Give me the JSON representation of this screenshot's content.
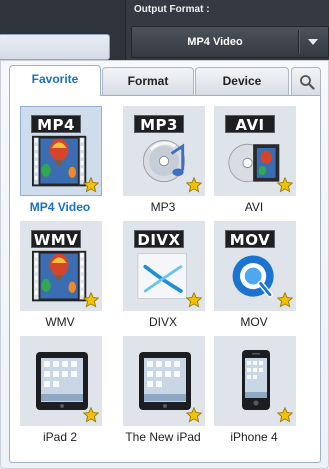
{
  "header": {
    "output_format_label": "Output Format :",
    "selected_format": "MP4 Video"
  },
  "tabs": [
    {
      "label": "Favorite",
      "active": true
    },
    {
      "label": "Format",
      "active": false
    },
    {
      "label": "Device",
      "active": false
    }
  ],
  "search_icon": "search-icon",
  "items": [
    {
      "label": "MP4 Video",
      "badge": "MP4",
      "kind": "video-film",
      "selected": true,
      "favorite": true
    },
    {
      "label": "MP3",
      "badge": "MP3",
      "kind": "audio-disc",
      "selected": false,
      "favorite": true
    },
    {
      "label": "AVI",
      "badge": "AVI",
      "kind": "disc-film",
      "selected": false,
      "favorite": true
    },
    {
      "label": "WMV",
      "badge": "WMV",
      "kind": "video-film",
      "selected": false,
      "favorite": true
    },
    {
      "label": "DIVX",
      "badge": "DIVX",
      "kind": "divx-logo",
      "selected": false,
      "favorite": true
    },
    {
      "label": "MOV",
      "badge": "MOV",
      "kind": "quicktime-logo",
      "selected": false,
      "favorite": true
    },
    {
      "label": "iPad 2",
      "badge": "",
      "kind": "tablet",
      "selected": false,
      "favorite": true
    },
    {
      "label": "The New iPad",
      "badge": "",
      "kind": "tablet",
      "selected": false,
      "favorite": true
    },
    {
      "label": "iPhone 4",
      "badge": "",
      "kind": "phone",
      "selected": false,
      "favorite": true
    }
  ],
  "colors": {
    "accent": "#1a6fc7",
    "selected_bg": "#cfdcec",
    "star": "#f2c200"
  }
}
